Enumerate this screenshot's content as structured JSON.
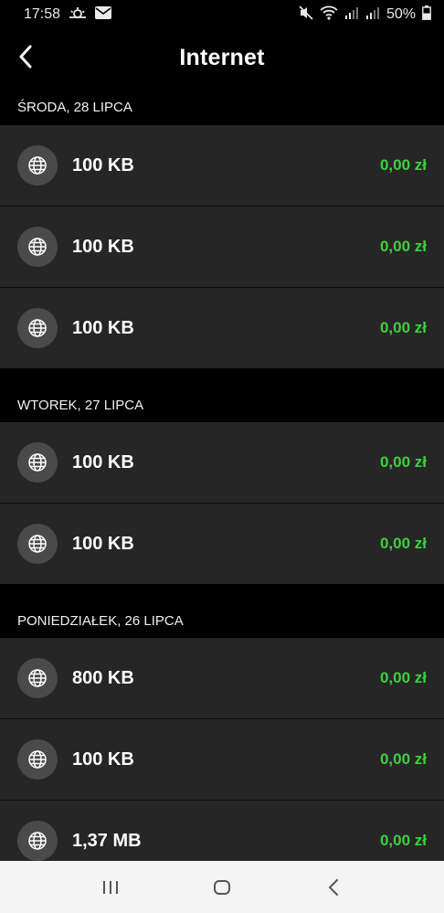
{
  "status_bar": {
    "time": "17:58",
    "battery": "50%"
  },
  "header": {
    "title": "Internet"
  },
  "sections": [
    {
      "date": "ŚRODA, 28 LIPCA",
      "rows": [
        {
          "amount": "100 KB",
          "price": "0,00 zł"
        },
        {
          "amount": "100 KB",
          "price": "0,00 zł"
        },
        {
          "amount": "100 KB",
          "price": "0,00 zł"
        }
      ]
    },
    {
      "date": "WTOREK, 27 LIPCA",
      "rows": [
        {
          "amount": "100 KB",
          "price": "0,00 zł"
        },
        {
          "amount": "100 KB",
          "price": "0,00 zł"
        }
      ]
    },
    {
      "date": "PONIEDZIAŁEK, 26 LIPCA",
      "rows": [
        {
          "amount": "800 KB",
          "price": "0,00 zł"
        },
        {
          "amount": "100 KB",
          "price": "0,00 zł"
        },
        {
          "amount": "1,37 MB",
          "price": "0,00 zł"
        }
      ]
    }
  ],
  "colors": {
    "background": "#000000",
    "row": "#262626",
    "price": "#3ad23c",
    "icon_bg": "#4a4a4a",
    "nav_bar": "#f4f4f4"
  },
  "icons": {
    "row_icon": "globe-icon",
    "back": "chevron-left-icon",
    "nav": [
      "recent-apps-icon",
      "home-icon",
      "back-icon"
    ]
  }
}
